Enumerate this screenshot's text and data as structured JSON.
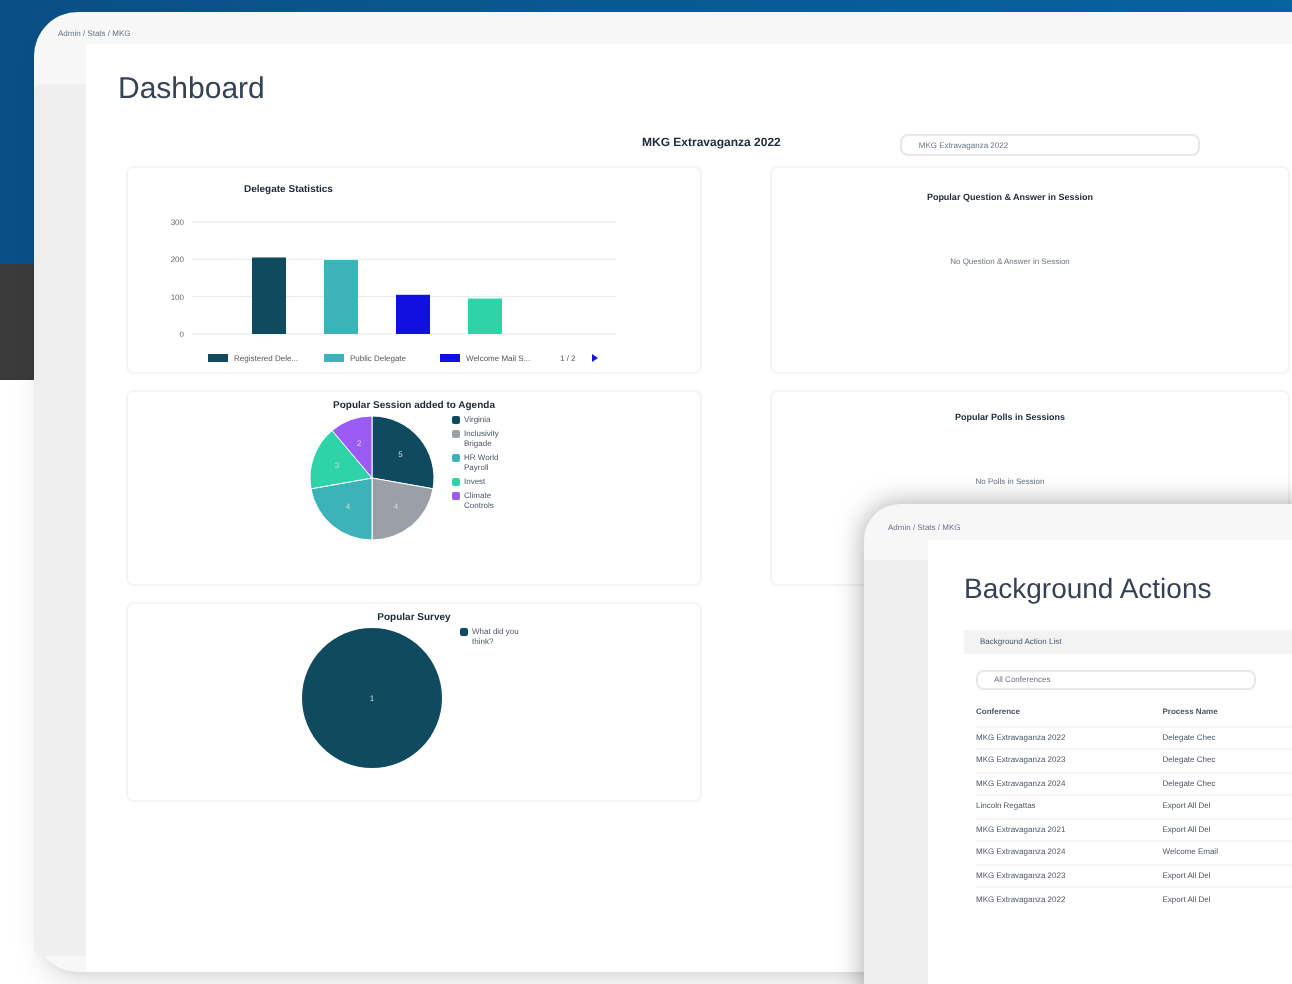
{
  "dashboard_window": {
    "breadcrumb": "Admin / Stats / MKG",
    "title": "Dashboard",
    "event_title": "MKG Extravaganza 2022",
    "event_select": {
      "value": "MKG Extravaganza 2022"
    },
    "delegate_statistics": {
      "chart_data": {
        "type": "bar",
        "title": "Delegate Statistics",
        "series": [
          {
            "name": "Registered Dele...",
            "color": "#0f4a5f",
            "values": [
              205
            ]
          },
          {
            "name": "Public Delegate",
            "color": "#3bb3b8",
            "values": [
              198
            ]
          },
          {
            "name": "Welcome Mail S...",
            "color": "#1010e0",
            "values": [
              105
            ]
          },
          {
            "color": "#2fd3a8",
            "values": [
              95
            ]
          }
        ],
        "ylim": [
          0,
          300
        ],
        "yticks": [
          0,
          100,
          200,
          300
        ],
        "legend": true
      },
      "legend_pager": "1 / 2"
    },
    "popular_sessions": {
      "chart_data": {
        "type": "pie",
        "title": "Popular Session added to Agenda",
        "categories": [
          "Virginia",
          "Inclusivity Brigade",
          "HR World Payroll",
          "Invest",
          "Climate Controls"
        ],
        "values": [
          5,
          4,
          4,
          3,
          2
        ],
        "colors": [
          "#0f4a5f",
          "#9aa0a6",
          "#3bb3b8",
          "#2fd3a8",
          "#9b5cf6"
        ],
        "data_labels": true,
        "legend": true
      }
    },
    "popular_survey": {
      "chart_data": {
        "type": "pie",
        "title": "Popular Survey",
        "categories": [
          "What did you think?"
        ],
        "values": [
          1
        ],
        "colors": [
          "#0f4a5f"
        ],
        "data_labels": true,
        "legend": true
      }
    },
    "popular_qa": {
      "title": "Popular Question & Answer in Session",
      "empty_text": "No Question & Answer in Session"
    },
    "popular_polls": {
      "title": "Popular Polls in Sessions",
      "empty_text": "No Polls in Session"
    }
  },
  "background_actions_window": {
    "breadcrumb": "Admin / Stats / MKG",
    "title": "Background Actions",
    "panel_title": "Background Action List",
    "conference_select": {
      "value": "All Conferences"
    },
    "table": {
      "columns": [
        "Conference",
        "Process Name"
      ],
      "rows": [
        [
          "MKG Extravaganza 2022",
          "Delegate Chec"
        ],
        [
          "MKG Extravaganza 2023",
          "Delegate Chec"
        ],
        [
          "MKG Extravaganza 2024",
          "Delegate Chec"
        ],
        [
          "Lincoln Regattas",
          "Export All Del"
        ],
        [
          "MKG Extravaganza 2021",
          "Export All Del"
        ],
        [
          "MKG Extravaganza 2024",
          "Welcome Email"
        ],
        [
          "MKG Extravaganza 2023",
          "Export All Del"
        ],
        [
          "MKG Extravaganza 2022",
          "Export All Del"
        ]
      ]
    }
  }
}
